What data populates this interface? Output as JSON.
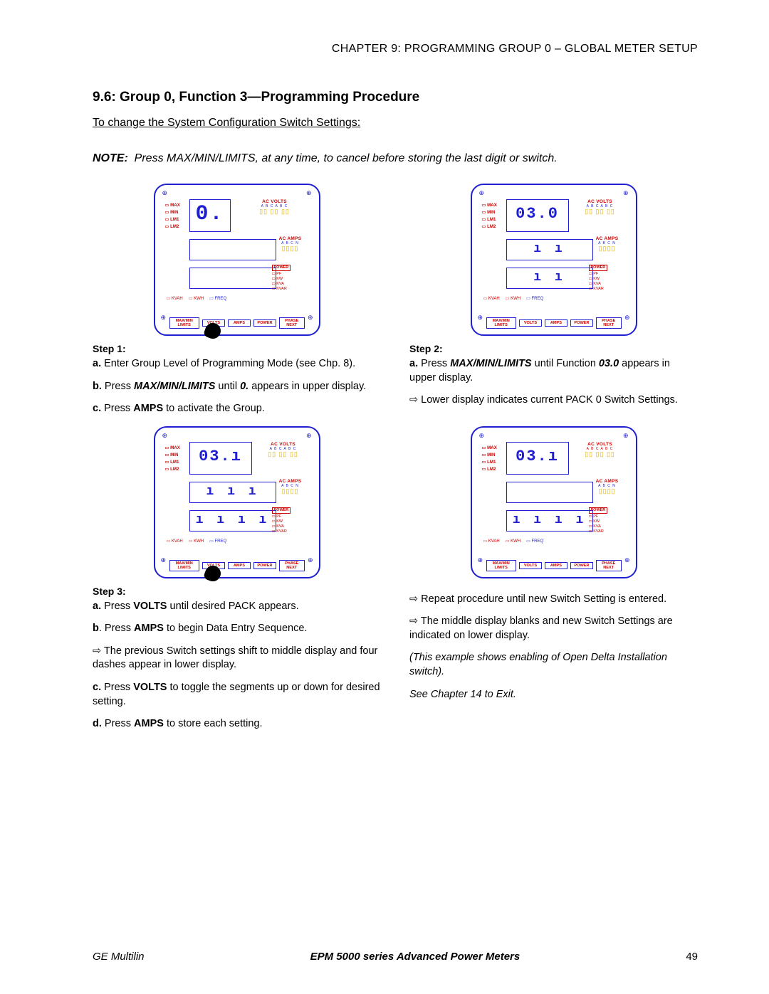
{
  "header": {
    "chapter": "CHAPTER 9: PROGRAMMING GROUP 0 – GLOBAL METER SETUP"
  },
  "section": {
    "title": "9.6: Group 0, Function 3—Programming Procedure"
  },
  "intro": "To change the System Configuration Switch Settings:",
  "note": {
    "label": "NOTE:",
    "body": "Press MAX/MIN/LIMITS, at any time, to cancel before storing the last digit or switch.",
    "bold_key": "MAX/MIN/LIMITS"
  },
  "meter_common": {
    "leds_left": [
      "MAX",
      "MIN",
      "LM1",
      "LM2"
    ],
    "ac_volts": "AC VOLTS",
    "abc_top": "A  B  C  A  B  C",
    "ac_amps": "AC AMPS",
    "abcn": "A  B  C  N",
    "power": "POWER",
    "pf": "PF",
    "kw": "KW",
    "kva": "KVA",
    "kvar": "KVAR",
    "kvah": "KVAH",
    "kwh": "KWH",
    "freq": "FREQ",
    "buttons": [
      "MAX/MIN\nLIMITS",
      "VOLTS",
      "AMPS",
      "POWER",
      "PHASE\nNEXT"
    ]
  },
  "meter1": {
    "big": "0.",
    "mid": "",
    "low": "",
    "thumb_on": "VOLTS"
  },
  "meter2": {
    "big": "03.0",
    "mid": "ı ı",
    "low": "ı ı",
    "thumb_on": null
  },
  "meter3": {
    "big": "03.ı",
    "mid": "ı ı ı",
    "low": "ı  ı  ı  ı",
    "thumb_on": "VOLTS"
  },
  "meter4": {
    "big": "03.ı",
    "mid": "",
    "low": "ı  ı  ı  ı",
    "abc_red_on": true,
    "thumb_on": null
  },
  "step1": {
    "hdr": "Step 1:",
    "a_pre": "a.",
    "a": " Enter Group Level of Programming Mode (see Chp. 8).",
    "b_pre": "b.",
    "b1": " Press ",
    "b_key": "MAX/MIN/LIMITS",
    "b2": " until ",
    "b_val": "0.",
    "b3": " appears in upper display.",
    "c_pre": "c.",
    "c1": " Press ",
    "c_key": "AMPS",
    "c2": " to activate the Group."
  },
  "step2": {
    "hdr": "Step 2:",
    "a_pre": "a.",
    "a1": " Press ",
    "a_key": "MAX/MIN/LIMITS",
    "a2": " until Function ",
    "a_val": "03.0",
    "a3": " appears in upper display.",
    "bullet": "⇨ Lower display indicates current PACK 0 Switch Settings."
  },
  "step3": {
    "hdr": "Step 3:",
    "a_pre": "a.",
    "a1": " Press ",
    "a_key": "VOLTS",
    "a2": " until desired PACK appears.",
    "b_pre": "b",
    "b1": ". Press ",
    "b_key": "AMPS",
    "b2": " to begin Data Entry Sequence.",
    "bullet1": "⇨ The previous Switch settings shift to middle display and four dashes appear in lower display.",
    "c_pre": "c.",
    "c1": " Press ",
    "c_key": "VOLTS",
    "c2": " to toggle the segments up or down for desired setting.",
    "d_pre": "d.",
    "d1": " Press ",
    "d_key": "AMPS",
    "d2": " to store each setting."
  },
  "step4": {
    "bullet1": "⇨ Repeat procedure until new Switch Setting is entered.",
    "bullet2": "⇨ The middle display blanks and new Switch Settings are indicated on lower display.",
    "italic1": "(This example shows enabling of Open Delta Installation switch).",
    "italic2": "See Chapter 14 to Exit."
  },
  "footer": {
    "brand": "GE Multilin",
    "doc": "EPM 5000 series Advanced Power Meters",
    "page": "49"
  }
}
